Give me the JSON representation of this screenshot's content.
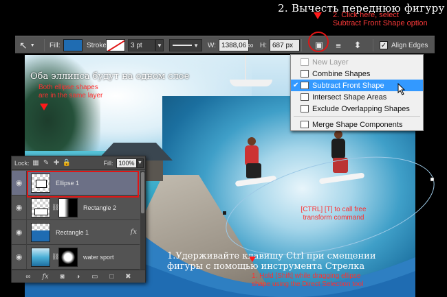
{
  "title_ru": "2. Вычесть переднюю фигуру",
  "hint_click": [
    "2. Click here, select",
    "Subtract Front Shape option"
  ],
  "options_bar": {
    "fill_label": "Fill:",
    "fill_color": "#1f6cb2",
    "stroke_label": "Stroke:",
    "stroke_width": "3 pt",
    "w_label": "W:",
    "w_value": "1388,06",
    "h_label": "H:",
    "h_value": "687 px",
    "align_edges_label": "Align Edges",
    "align_edges_checked": true
  },
  "path_menu": {
    "items": [
      {
        "label": "New Layer",
        "state": "disabled",
        "checked": false
      },
      {
        "label": "Combine Shapes",
        "state": "normal",
        "checked": false
      },
      {
        "label": "Subtract Front Shape",
        "state": "active",
        "checked": true
      },
      {
        "label": "Intersect Shape Areas",
        "state": "normal",
        "checked": false
      },
      {
        "label": "Exclude Overlapping Shapes",
        "state": "normal",
        "checked": false
      },
      {
        "label": "Merge Shape Components",
        "state": "normal",
        "checked": false
      }
    ]
  },
  "captions": {
    "same_layer_ru": "Оба эллипса будут на одном слое",
    "same_layer_en": [
      "Both ellipse shapes",
      "are in the same layer"
    ],
    "ctrl_t": [
      "[CTRL] [T] to call free",
      "transform command"
    ],
    "hold_ru": [
      "1.Удерживайте клавишу Ctrl при смещении",
      "фигуры с помощью инструмента Стрелка"
    ],
    "hold_en": [
      "1. Hold [Shift] while dragging ellipse",
      "shape using the Direct Selection tool"
    ]
  },
  "layers": {
    "lock_label": "Lock:",
    "fill_label": "Fill:",
    "fill_value": "100%",
    "rows": [
      {
        "name": "Ellipse 1",
        "selected": true,
        "fx": false
      },
      {
        "name": "Rectangle 2",
        "selected": false,
        "fx": false
      },
      {
        "name": "Rectangle 1",
        "selected": false,
        "fx": true
      },
      {
        "name": "water sport",
        "selected": false,
        "fx": false
      }
    ]
  },
  "colors": {
    "accent_red": "#e01515",
    "menu_highlight": "#3399ff",
    "shape_blue": "#1f6cb2"
  }
}
